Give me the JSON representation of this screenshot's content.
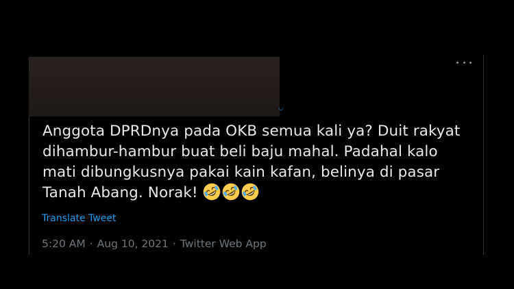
{
  "tweet": {
    "text_lines": [
      "Anggota DPRDnya pada OKB semua kali ya? Duit rakyat",
      "dihambur-hambur buat beli baju mahal. Padahal kalo",
      "mati dibungkusnya pakai kain kafan, belinya di pasar",
      "Tanah Abang. Norak! "
    ],
    "emoji": [
      "rolling-on-floor-laughing",
      "rolling-on-floor-laughing",
      "rolling-on-floor-laughing"
    ],
    "translate_label": "Translate Tweet",
    "time": "5:20 AM",
    "date": "Aug 10, 2021",
    "source": "Twitter Web App",
    "separator": "·"
  },
  "icons": {
    "more": "more-horizontal-icon",
    "verified": "verified-badge-icon"
  },
  "colors": {
    "background": "#000000",
    "text": "#e7e9ea",
    "link": "#1d9bf0",
    "muted": "#71767b",
    "redacted": "#241d1b"
  }
}
